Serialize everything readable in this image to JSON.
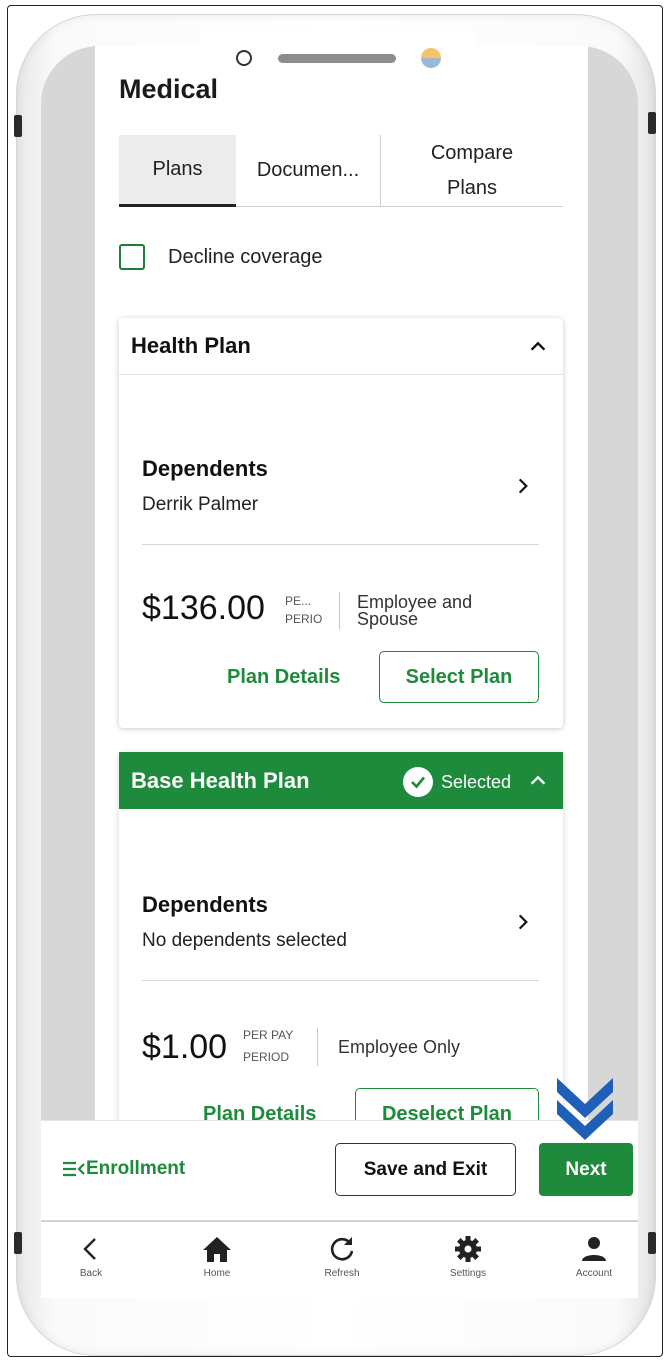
{
  "section_title": "Medical",
  "tabs": [
    {
      "label": "Plans"
    },
    {
      "label": "Documen..."
    },
    {
      "label_line1": "Compare",
      "label_line2": "Plans"
    }
  ],
  "decline_label": "Decline coverage",
  "plans": [
    {
      "name": "Health Plan",
      "dependents_label": "Dependents",
      "dependents_value": "Derrik Palmer",
      "price": "$136.00",
      "per_line1": "PE...",
      "per_line2": "PERIOD",
      "coverage_line1": "Employee and",
      "coverage_line2": "Spouse",
      "details_label": "Plan Details",
      "action_label": "Select Plan"
    },
    {
      "name": "Base Health Plan",
      "selected_label": "Selected",
      "dependents_label": "Dependents",
      "dependents_value": "No dependents selected",
      "price": "$1.00",
      "per_line1": "PER PAY",
      "per_line2": "PERIOD",
      "coverage": "Employee Only",
      "details_label": "Plan Details",
      "action_label": "Deselect Plan"
    }
  ],
  "footer": {
    "enrollment_label": "Enrollment",
    "save_label": "Save and Exit",
    "next_label": "Next"
  },
  "nav": [
    {
      "label": "Back",
      "icon": "chevron-left-icon"
    },
    {
      "label": "Home",
      "icon": "home-icon"
    },
    {
      "label": "Refresh",
      "icon": "refresh-icon"
    },
    {
      "label": "Settings",
      "icon": "gear-icon"
    },
    {
      "label": "Account",
      "icon": "person-icon"
    }
  ],
  "colors": {
    "accent": "#1e8a3c",
    "hint_arrow": "#1f5fb8"
  }
}
